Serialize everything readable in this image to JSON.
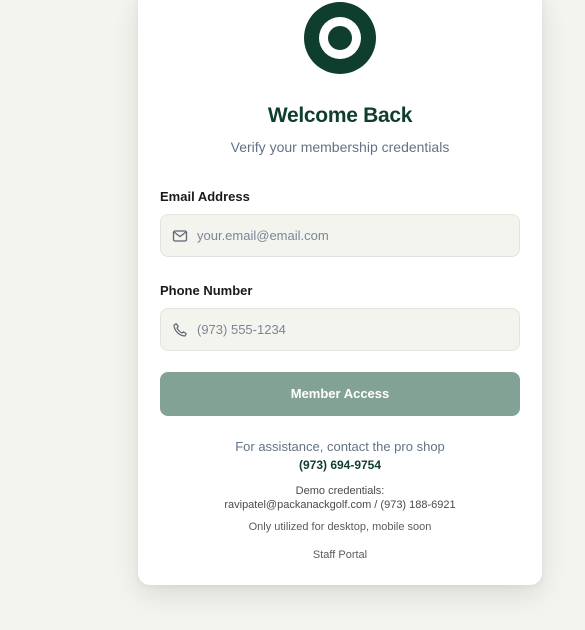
{
  "header": {
    "logo_icon": "target-icon",
    "title": "Welcome Back",
    "subtitle": "Verify your membership credentials"
  },
  "form": {
    "email": {
      "label": "Email Address",
      "placeholder": "your.email@email.com",
      "value": "",
      "icon": "mail-icon"
    },
    "phone": {
      "label": "Phone Number",
      "placeholder": "(973) 555-1234",
      "value": "",
      "icon": "phone-icon"
    },
    "submit_label": "Member Access"
  },
  "footer": {
    "assist_text": "For assistance, contact the pro shop",
    "assist_phone": "(973) 694-9754",
    "demo_heading": "Demo credentials:",
    "demo_credentials": "ravipatel@packanackgolf.com / (973) 188-6921",
    "demo_note": "Only utilized for desktop, mobile soon",
    "staff_link": "Staff Portal"
  },
  "colors": {
    "brand": "#0f3d2e",
    "button": "#82a295",
    "page_bg": "#f4f4ef",
    "input_bg": "#f4f4ef"
  }
}
